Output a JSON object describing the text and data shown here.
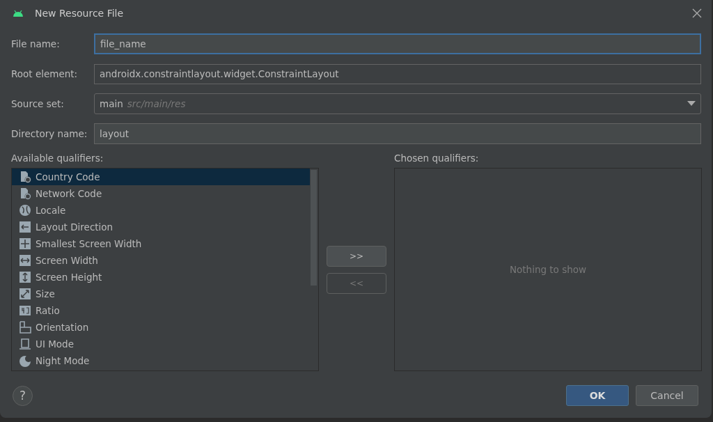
{
  "window": {
    "title": "New Resource File"
  },
  "fields": [
    {
      "kind": "text",
      "label": "File name:",
      "value": "file_name",
      "focused": true
    },
    {
      "kind": "readonly",
      "label": "Root element:",
      "value": "androidx.constraintlayout.widget.ConstraintLayout"
    },
    {
      "kind": "combo",
      "label": "Source set:",
      "value": "main",
      "hint": "src/main/res"
    },
    {
      "kind": "text",
      "label": "Directory name:",
      "value": "layout",
      "focused": false
    }
  ],
  "available": {
    "label": "Available qualifiers:",
    "items": [
      {
        "label": "Country Code",
        "selected": true
      },
      {
        "label": "Network Code",
        "selected": false
      },
      {
        "label": "Locale",
        "selected": false
      },
      {
        "label": "Layout Direction",
        "selected": false
      },
      {
        "label": "Smallest Screen Width",
        "selected": false
      },
      {
        "label": "Screen Width",
        "selected": false
      },
      {
        "label": "Screen Height",
        "selected": false
      },
      {
        "label": "Size",
        "selected": false
      },
      {
        "label": "Ratio",
        "selected": false
      },
      {
        "label": "Orientation",
        "selected": false
      },
      {
        "label": "UI Mode",
        "selected": false
      },
      {
        "label": "Night Mode",
        "selected": false
      }
    ]
  },
  "move_buttons": [
    {
      "label": ">>",
      "disabled": false
    },
    {
      "label": "<<",
      "disabled": true
    }
  ],
  "chosen": {
    "label": "Chosen qualifiers:",
    "empty_text": "Nothing to show"
  },
  "help": "?",
  "buttons": [
    {
      "label": "OK",
      "default": true
    },
    {
      "label": "Cancel",
      "default": false
    }
  ]
}
